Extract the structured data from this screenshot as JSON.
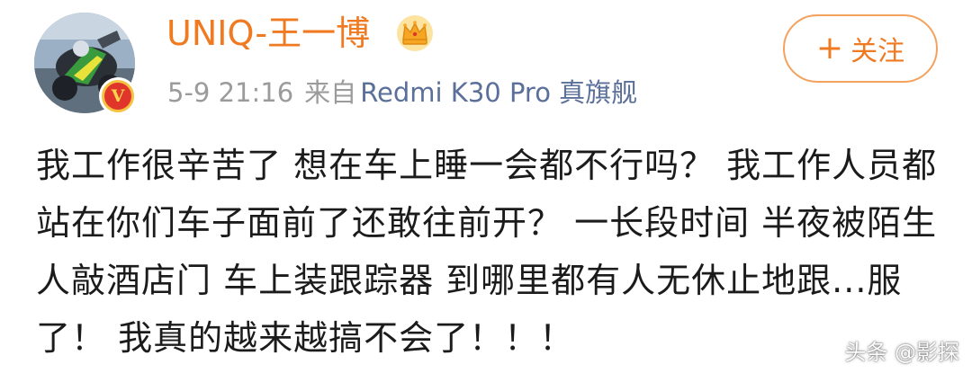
{
  "post": {
    "author": {
      "name": "UNIQ-王一博",
      "verified_badge": "V",
      "crown_icon": "crown-icon"
    },
    "time": "5-9 21:16",
    "source_prefix": "来自",
    "device": "Redmi K30 Pro 真旗舰",
    "follow_label": "关注",
    "follow_icon": "+",
    "text": "我工作很辛苦了 想在车上睡一会都不行吗？ 我工作人员都站在你们车子面前了还敢往前开？ 一长段时间 半夜被陌生人敲酒店门 车上装跟踪器 到哪里都有人无休止地跟...服了！ 我真的越来越搞不会了！！！"
  },
  "watermark": "头条 @影探",
  "colors": {
    "accent": "#f07a22",
    "device_link": "#5a6f9a",
    "meta_gray": "#9b9b9b",
    "body_text": "#1b1b1b"
  }
}
